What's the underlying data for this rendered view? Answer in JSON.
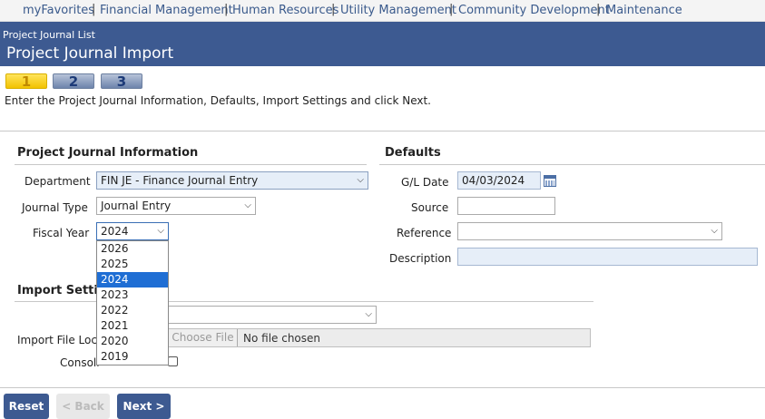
{
  "nav": {
    "items": [
      "myFavorites",
      "Financial Management",
      "Human Resources",
      "Utility Management",
      "Community Development",
      "Maintenance"
    ],
    "separator": "|"
  },
  "header": {
    "breadcrumb": "Project Journal List",
    "title": "Project Journal Import"
  },
  "wizard": {
    "steps": [
      "1",
      "2",
      "3"
    ],
    "active_step": 1,
    "instructions": "Enter the Project Journal Information, Defaults, Import Settings and click Next."
  },
  "project_info": {
    "section_title": "Project Journal Information",
    "department_label": "Department",
    "department_value": "FIN JE - Finance Journal Entry",
    "journal_type_label": "Journal Type",
    "journal_type_value": "Journal Entry",
    "fiscal_year_label": "Fiscal Year",
    "fiscal_year_value": "2024",
    "fiscal_year_options": [
      "2026",
      "2025",
      "2024",
      "2023",
      "2022",
      "2021",
      "2020",
      "2019"
    ]
  },
  "defaults": {
    "section_title": "Defaults",
    "gl_date_label": "G/L Date",
    "gl_date_value": "04/03/2024",
    "source_label": "Source",
    "source_value": "",
    "reference_label": "Reference",
    "reference_value": "",
    "description_label": "Description",
    "description_value": ""
  },
  "import_settings": {
    "section_title": "Import Setting",
    "format_value": "",
    "file_location_label": "Import File Locat",
    "choose_file_label": "Choose File",
    "no_file_text": "No file chosen",
    "consolidate_label": "Consoli"
  },
  "buttons": {
    "reset": "Reset",
    "back": "< Back",
    "next": "Next >"
  },
  "colors": {
    "header_bg": "#3d5a91",
    "nav_link": "#3a5a8c",
    "active_step": "#f2c200",
    "selected_option": "#1f6ed4"
  }
}
